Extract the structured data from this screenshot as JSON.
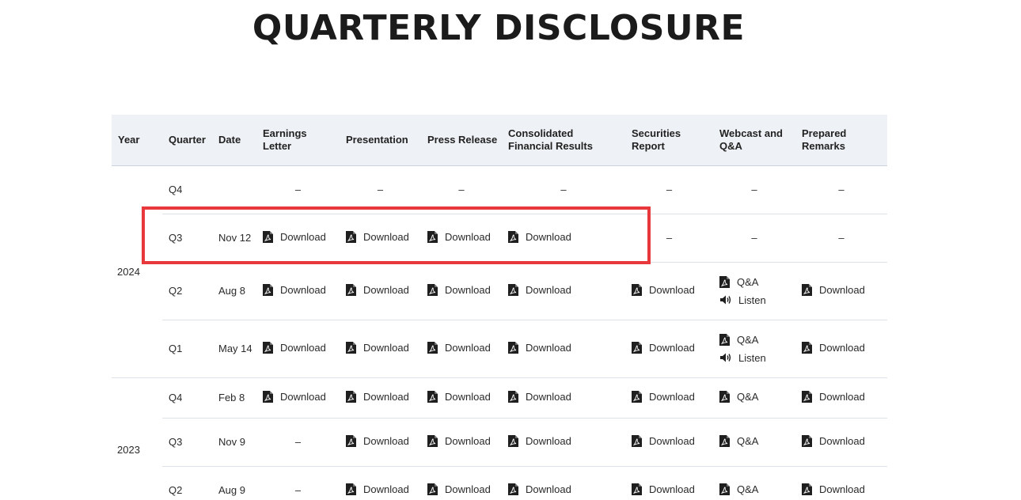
{
  "page": {
    "title": "QUARTERLY DISCLOSURE"
  },
  "columns": {
    "year": "Year",
    "quarter": "Quarter",
    "date": "Date",
    "earnings_letter": "Earnings Letter",
    "presentation": "Presentation",
    "press_release": "Press Release",
    "consolidated": "Consolidated Financial Results",
    "securities_report": "Securities Report",
    "webcast": "Webcast and Q&A",
    "prepared_remarks": "Prepared Remarks"
  },
  "labels": {
    "download": "Download",
    "qa": "Q&A",
    "listen": "Listen",
    "dash": "–"
  },
  "years": [
    {
      "year": "2024",
      "rows": [
        {
          "quarter": "Q4",
          "date": ""
        },
        {
          "quarter": "Q3",
          "date": "Nov 12"
        },
        {
          "quarter": "Q2",
          "date": "Aug 8"
        },
        {
          "quarter": "Q1",
          "date": "May 14"
        }
      ]
    },
    {
      "year": "2023",
      "rows": [
        {
          "quarter": "Q4",
          "date": "Feb 8"
        },
        {
          "quarter": "Q3",
          "date": "Nov 9"
        },
        {
          "quarter": "Q2",
          "date": "Aug 9"
        }
      ]
    }
  ],
  "annotation": {
    "highlight_color": "#e8383b"
  }
}
